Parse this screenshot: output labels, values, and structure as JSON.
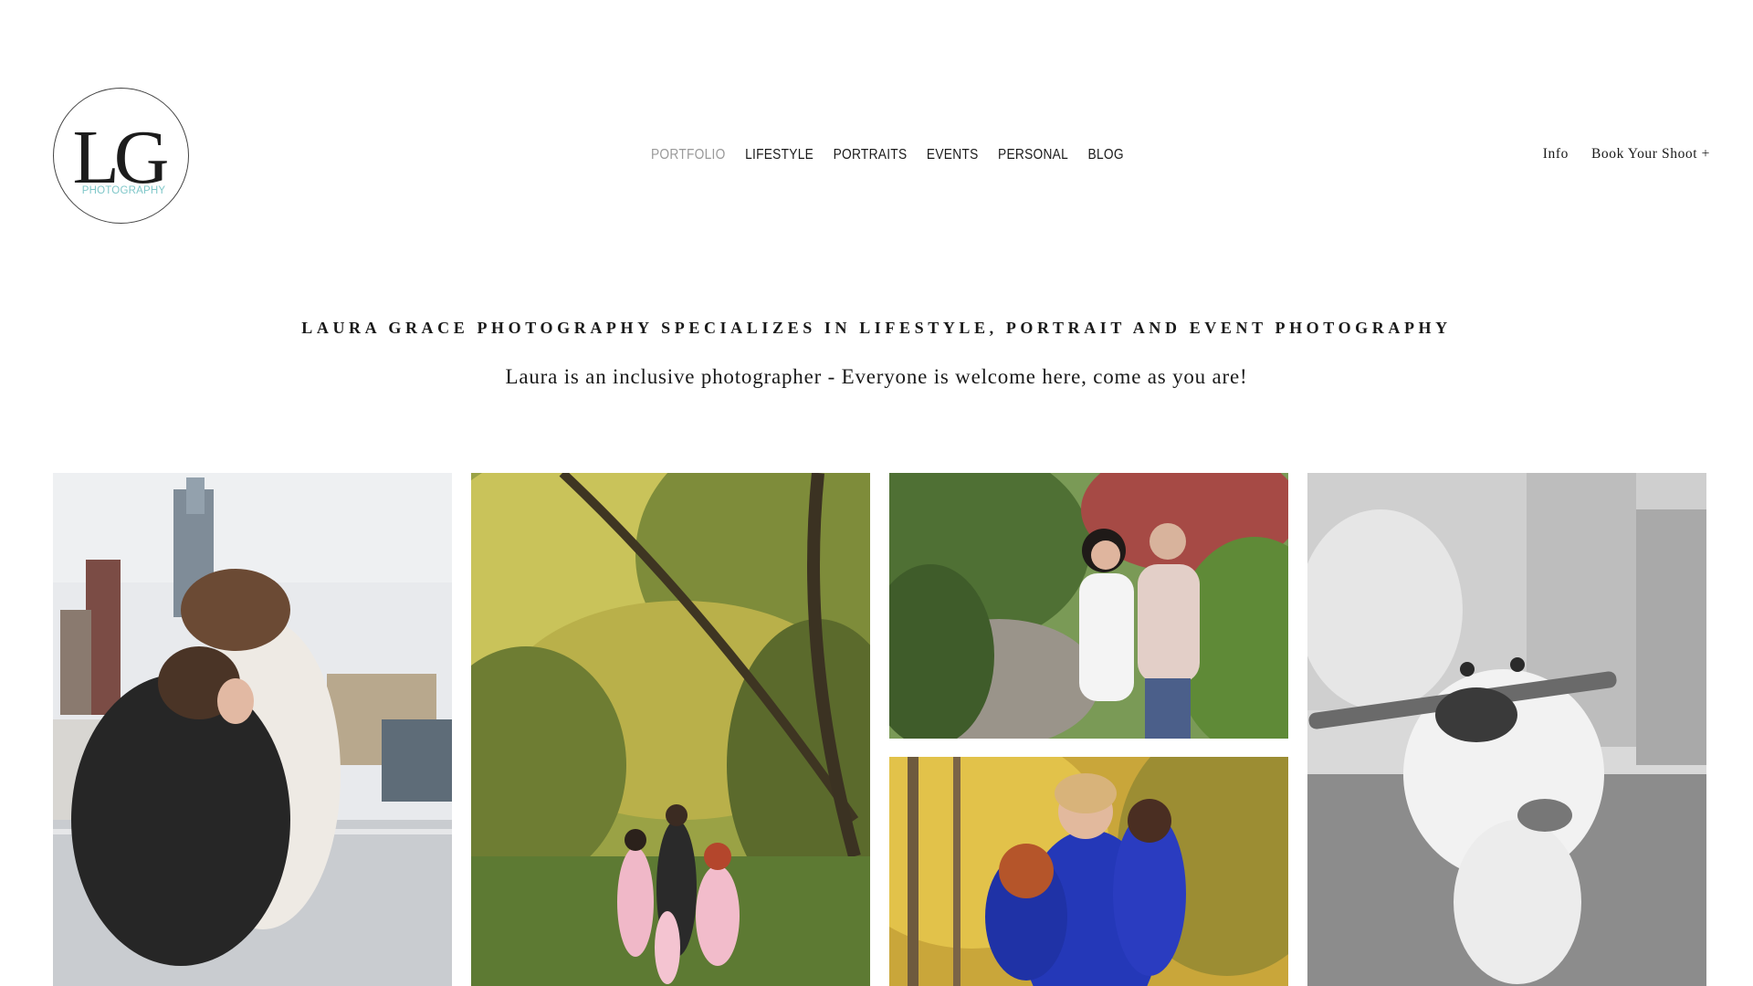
{
  "logo": {
    "monogram": "LG",
    "subtitle": "PHOTOGRAPHY",
    "accent_color": "#7fc7c9"
  },
  "nav": {
    "items": [
      {
        "label": "Portfolio",
        "active": true
      },
      {
        "label": "Lifestyle",
        "active": false
      },
      {
        "label": "Portraits",
        "active": false
      },
      {
        "label": "Events",
        "active": false
      },
      {
        "label": "Personal",
        "active": false
      },
      {
        "label": "Blog",
        "active": false
      }
    ]
  },
  "utility_nav": {
    "info": "Info",
    "book": "Book Your Shoot +"
  },
  "intro": {
    "tagline": "Laura Grace Photography specializes in lifestyle, portrait and event photography",
    "subline": "Laura is an inclusive photographer - Everyone is welcome here, come as you are!"
  },
  "gallery": [
    {
      "kind": "photo",
      "icon": "couple-rooftop-city-photo"
    },
    {
      "kind": "photo",
      "icon": "family-forest-autumn-photo"
    },
    {
      "kind": "photo",
      "icon": "couple-garden-photo"
    },
    {
      "kind": "photo",
      "icon": "mother-daughters-autumn-photo"
    },
    {
      "kind": "photo",
      "icon": "dog-with-stick-bw-photo"
    }
  ]
}
